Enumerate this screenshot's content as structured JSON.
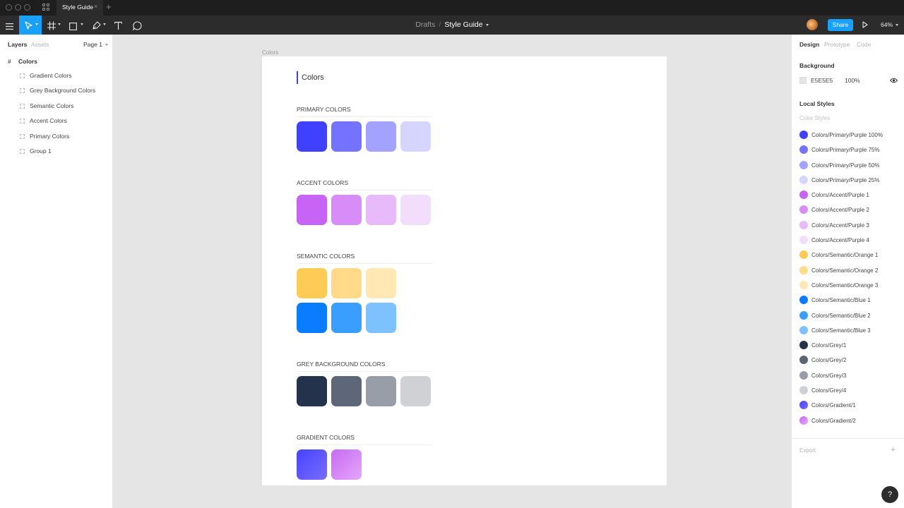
{
  "titlebar": {
    "tab_title": "Style Guide",
    "tab_close": "×",
    "new_tab": "+"
  },
  "toolbar": {
    "breadcrumb_root": "Drafts",
    "breadcrumb_separator": "/",
    "file_name": "Style Guide",
    "share_label": "Share",
    "zoom": "64%"
  },
  "layers_panel": {
    "tab_layers": "Layers",
    "tab_assets": "Assets",
    "page": "Page 1",
    "frame": "Colors",
    "items": [
      "Gradient Colors",
      "Grey Background Colors",
      "Semantic Colors",
      "Accent Colors",
      "Primary Colors",
      "Group 1"
    ]
  },
  "canvas": {
    "frame_label": "Colors",
    "title": "Colors",
    "sections": [
      {
        "title": "PRIMARY COLORS",
        "rows": [
          [
            "#4040FF",
            "#7373FF",
            "#A3A3FF",
            "#D5D5FF"
          ]
        ]
      },
      {
        "title": "ACCENT COLORS",
        "rows": [
          [
            "#C864F5",
            "#D88CF7",
            "#E9BAFA",
            "#F3DDFC"
          ]
        ]
      },
      {
        "title": "SEMANTIC COLORS",
        "rows": [
          [
            "#FFCB57",
            "#FFDB89",
            "#FFE8B3"
          ],
          [
            "#0A7CFF",
            "#3A9EFF",
            "#7EC1FF"
          ]
        ]
      },
      {
        "title": "GREY BACKGROUND COLORS",
        "rows": [
          [
            "#25324B",
            "#5E6778",
            "#989EA8",
            "#CFD1D5"
          ]
        ]
      },
      {
        "title": "GRADIENT COLORS",
        "rows": [
          [
            "gradient-1",
            "gradient-2"
          ]
        ]
      }
    ],
    "gradients": {
      "gradient-1": [
        "#4444FF",
        "#7A6CFF"
      ],
      "gradient-2": [
        "#C56AF2",
        "#E6A6FA"
      ]
    }
  },
  "design_panel": {
    "tabs": [
      "Design",
      "Prototype",
      "Code"
    ],
    "background_heading": "Background",
    "background_hex": "E5E5E5",
    "background_opacity": "100%",
    "local_styles_heading": "Local Styles",
    "color_styles_heading": "Color Styles",
    "styles": [
      {
        "name": "Colors/Primary/Purple 100%",
        "color": "#4040FF"
      },
      {
        "name": "Colors/Primary/Purple 75%",
        "color": "#7373FF"
      },
      {
        "name": "Colors/Primary/Purple 50%",
        "color": "#A3A3FF"
      },
      {
        "name": "Colors/Primary/Purple 25%",
        "color": "#D5D5FF"
      },
      {
        "name": "Colors/Accent/Purple 1",
        "color": "#C864F5"
      },
      {
        "name": "Colors/Accent/Purple 2",
        "color": "#D88CF7"
      },
      {
        "name": "Colors/Accent/Purple 3",
        "color": "#E9BAFA"
      },
      {
        "name": "Colors/Accent/Purple 4",
        "color": "#F3DDFC"
      },
      {
        "name": "Colors/Semantic/Orange 1",
        "color": "#FFCB57"
      },
      {
        "name": "Colors/Semantic/Orange 2",
        "color": "#FFDB89"
      },
      {
        "name": "Colors/Semantic/Orange 3",
        "color": "#FFE8B3"
      },
      {
        "name": "Colors/Semantic/Blue 1",
        "color": "#0A7CFF"
      },
      {
        "name": "Colors/Semantic/Blue 2",
        "color": "#3A9EFF"
      },
      {
        "name": "Colors/Semantic/Blue 3",
        "color": "#7EC1FF"
      },
      {
        "name": "Colors/Grey/1",
        "color": "#25324B"
      },
      {
        "name": "Colors/Grey/2",
        "color": "#5E6778"
      },
      {
        "name": "Colors/Grey/3",
        "color": "#989EA8"
      },
      {
        "name": "Colors/Grey/4",
        "color": "#CFD1D5"
      },
      {
        "name": "Colors/Gradient/1",
        "color": "gradient-1"
      },
      {
        "name": "Colors/Gradient/2",
        "color": "gradient-2"
      }
    ],
    "export_label": "Export",
    "export_add": "+"
  },
  "help": {
    "label": "?"
  },
  "colors": {
    "accent": "#18A0FB",
    "toolbar": "#2C2C2C",
    "titlebar": "#1E1E1E"
  }
}
